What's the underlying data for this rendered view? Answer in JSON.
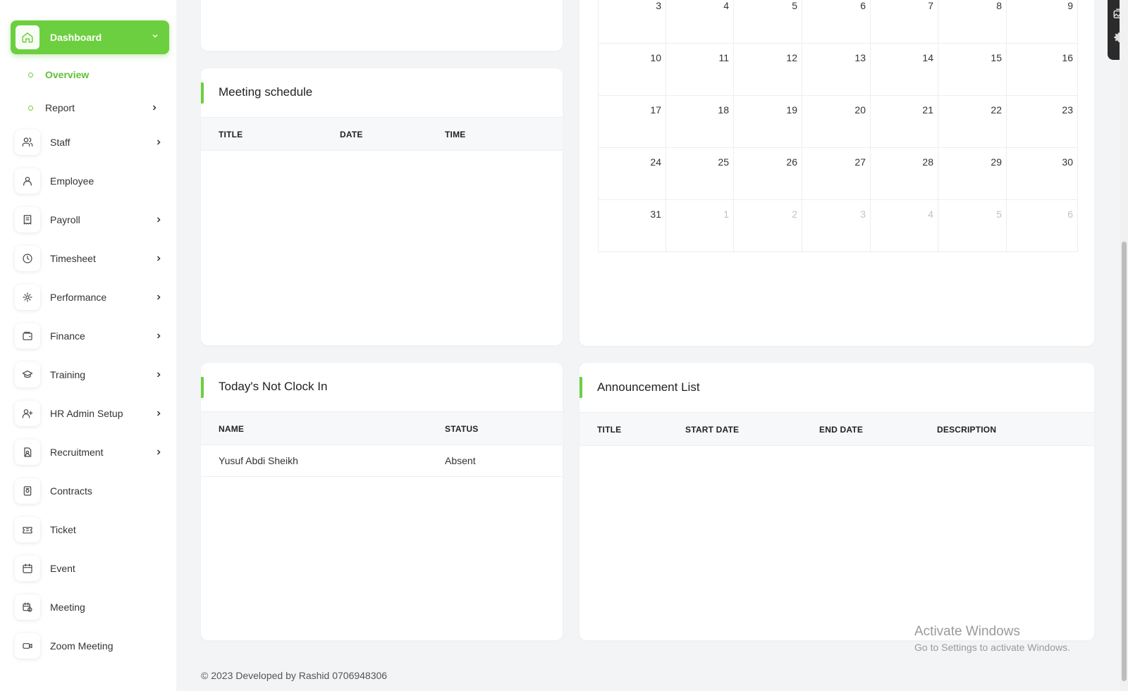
{
  "sidebar": {
    "dashboard": "Dashboard",
    "overview": "Overview",
    "report": "Report",
    "items": [
      {
        "label": "Staff",
        "icon": "users-icon",
        "chevron": true
      },
      {
        "label": "Employee",
        "icon": "user-icon",
        "chevron": false
      },
      {
        "label": "Payroll",
        "icon": "receipt-icon",
        "chevron": true
      },
      {
        "label": "Timesheet",
        "icon": "clock-icon",
        "chevron": true
      },
      {
        "label": "Performance",
        "icon": "target-icon",
        "chevron": true
      },
      {
        "label": "Finance",
        "icon": "wallet-icon",
        "chevron": true
      },
      {
        "label": "Training",
        "icon": "graduation-cap-icon",
        "chevron": true
      },
      {
        "label": "HR Admin Setup",
        "icon": "user-plus-icon",
        "chevron": true
      },
      {
        "label": "Recruitment",
        "icon": "file-user-icon",
        "chevron": true
      },
      {
        "label": "Contracts",
        "icon": "contract-icon",
        "chevron": false
      },
      {
        "label": "Ticket",
        "icon": "ticket-icon",
        "chevron": false
      },
      {
        "label": "Event",
        "icon": "calendar-icon",
        "chevron": false
      },
      {
        "label": "Meeting",
        "icon": "calendar-clock-icon",
        "chevron": false
      },
      {
        "label": "Zoom Meeting",
        "icon": "video-icon",
        "chevron": false
      }
    ]
  },
  "meeting": {
    "title": "Meeting schedule",
    "columns": [
      "TITLE",
      "DATE",
      "TIME"
    ]
  },
  "calendar": {
    "weeks": [
      [
        {
          "d": "3"
        },
        {
          "d": "4"
        },
        {
          "d": "5"
        },
        {
          "d": "6"
        },
        {
          "d": "7"
        },
        {
          "d": "8"
        },
        {
          "d": "9"
        }
      ],
      [
        {
          "d": "10"
        },
        {
          "d": "11"
        },
        {
          "d": "12"
        },
        {
          "d": "13"
        },
        {
          "d": "14"
        },
        {
          "d": "15"
        },
        {
          "d": "16"
        }
      ],
      [
        {
          "d": "17"
        },
        {
          "d": "18"
        },
        {
          "d": "19"
        },
        {
          "d": "20"
        },
        {
          "d": "21"
        },
        {
          "d": "22"
        },
        {
          "d": "23"
        }
      ],
      [
        {
          "d": "24"
        },
        {
          "d": "25"
        },
        {
          "d": "26"
        },
        {
          "d": "27"
        },
        {
          "d": "28"
        },
        {
          "d": "29"
        },
        {
          "d": "30"
        }
      ],
      [
        {
          "d": "31"
        },
        {
          "d": "1",
          "other": true
        },
        {
          "d": "2",
          "other": true
        },
        {
          "d": "3",
          "other": true
        },
        {
          "d": "4",
          "other": true
        },
        {
          "d": "5",
          "other": true
        },
        {
          "d": "6",
          "other": true
        }
      ]
    ]
  },
  "not_clock_in": {
    "title": "Today's Not Clock In",
    "columns": [
      "NAME",
      "STATUS"
    ],
    "rows": [
      {
        "name": "Yusuf Abdi Sheikh",
        "status": "Absent"
      }
    ]
  },
  "announcement": {
    "title": "Announcement List",
    "columns": [
      "TITLE",
      "START DATE",
      "END DATE",
      "DESCRIPTION"
    ]
  },
  "footer": "© 2023 Developed by Rashid 0706948306",
  "watermark": {
    "line1": "Activate Windows",
    "line2": "Go to Settings to activate Windows."
  },
  "colors": {
    "accent": "#6ccf3f"
  }
}
